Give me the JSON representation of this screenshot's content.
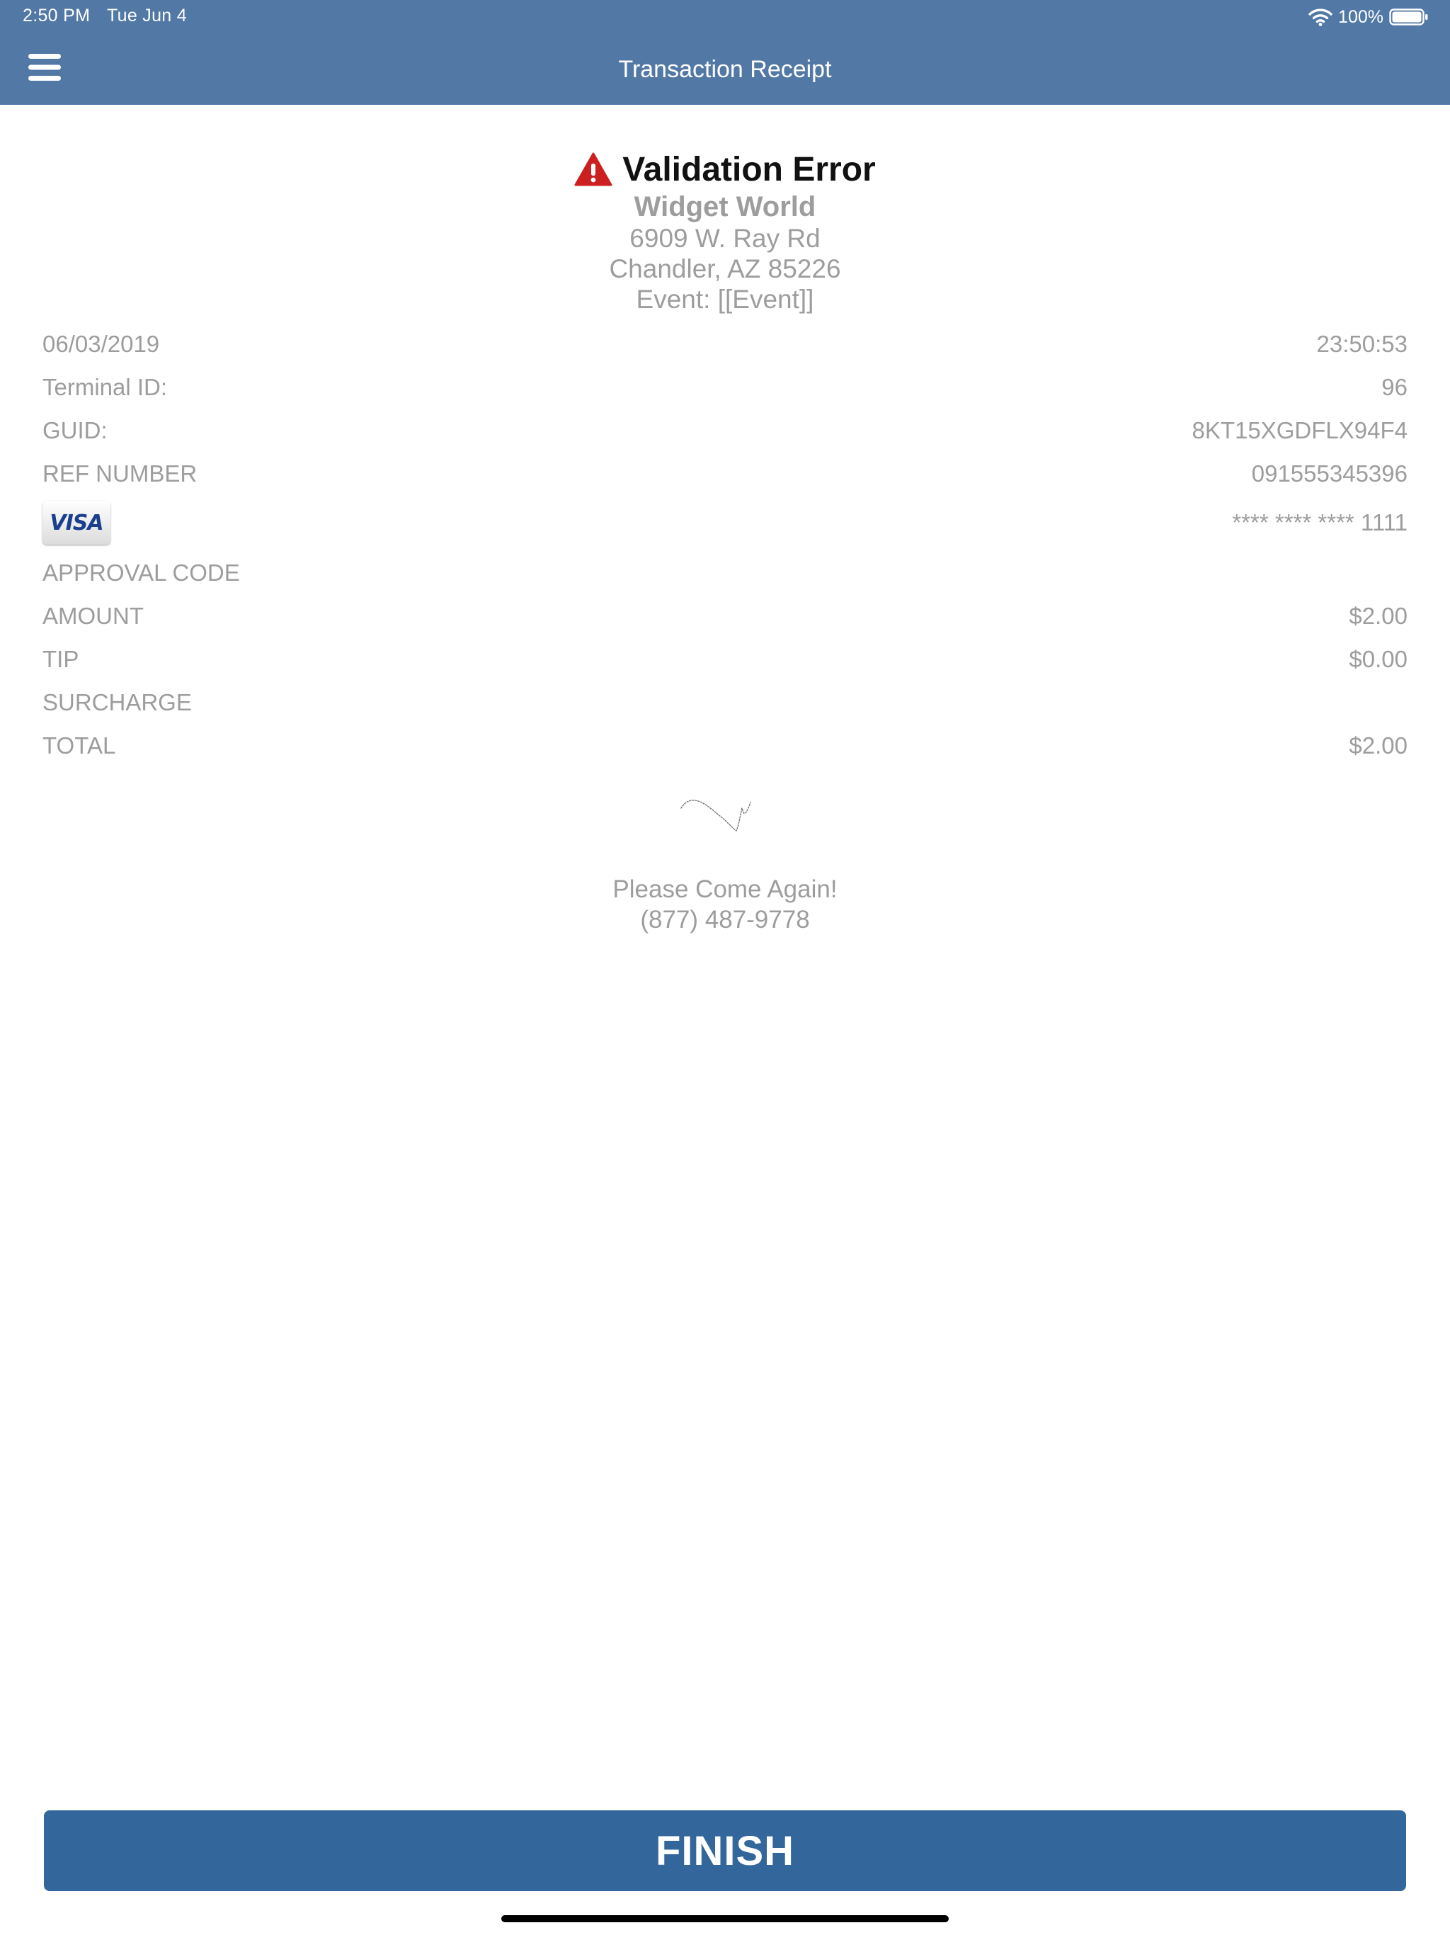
{
  "status_bar": {
    "time": "2:50 PM",
    "date": "Tue Jun 4",
    "battery": "100%"
  },
  "nav": {
    "title": "Transaction Receipt",
    "menu_icon": "hamburger-menu-icon"
  },
  "receipt": {
    "status_icon": "warning-triangle-icon",
    "status_title": "Validation Error",
    "merchant": "Widget World",
    "address_line1": "6909 W. Ray Rd",
    "address_line2": "Chandler, AZ 85226",
    "event": "Event: [[Event]]",
    "date": "06/03/2019",
    "time": "23:50:53",
    "rows": [
      {
        "label": "Terminal ID:",
        "value": "96"
      },
      {
        "label": "GUID:",
        "value": "8KT15XGDFLX94F4"
      },
      {
        "label": "REF NUMBER",
        "value": "091555345396"
      }
    ],
    "card": {
      "brand": "VISA",
      "masked_number": "**** **** **** 1111"
    },
    "totals": [
      {
        "label": "APPROVAL CODE",
        "value": ""
      },
      {
        "label": "AMOUNT",
        "value": "$2.00"
      },
      {
        "label": "TIP",
        "value": "$0.00"
      },
      {
        "label": "SURCHARGE",
        "value": ""
      },
      {
        "label": "TOTAL",
        "value": "$2.00"
      }
    ],
    "footer_message": "Please Come Again!",
    "phone": "(877) 487-9778"
  },
  "actions": {
    "finish_label": "FINISH"
  },
  "colors": {
    "nav_background": "#5278a6",
    "button_background": "#33669a",
    "warning": "#cc1f1f",
    "muted_text": "#9d9d9d"
  }
}
